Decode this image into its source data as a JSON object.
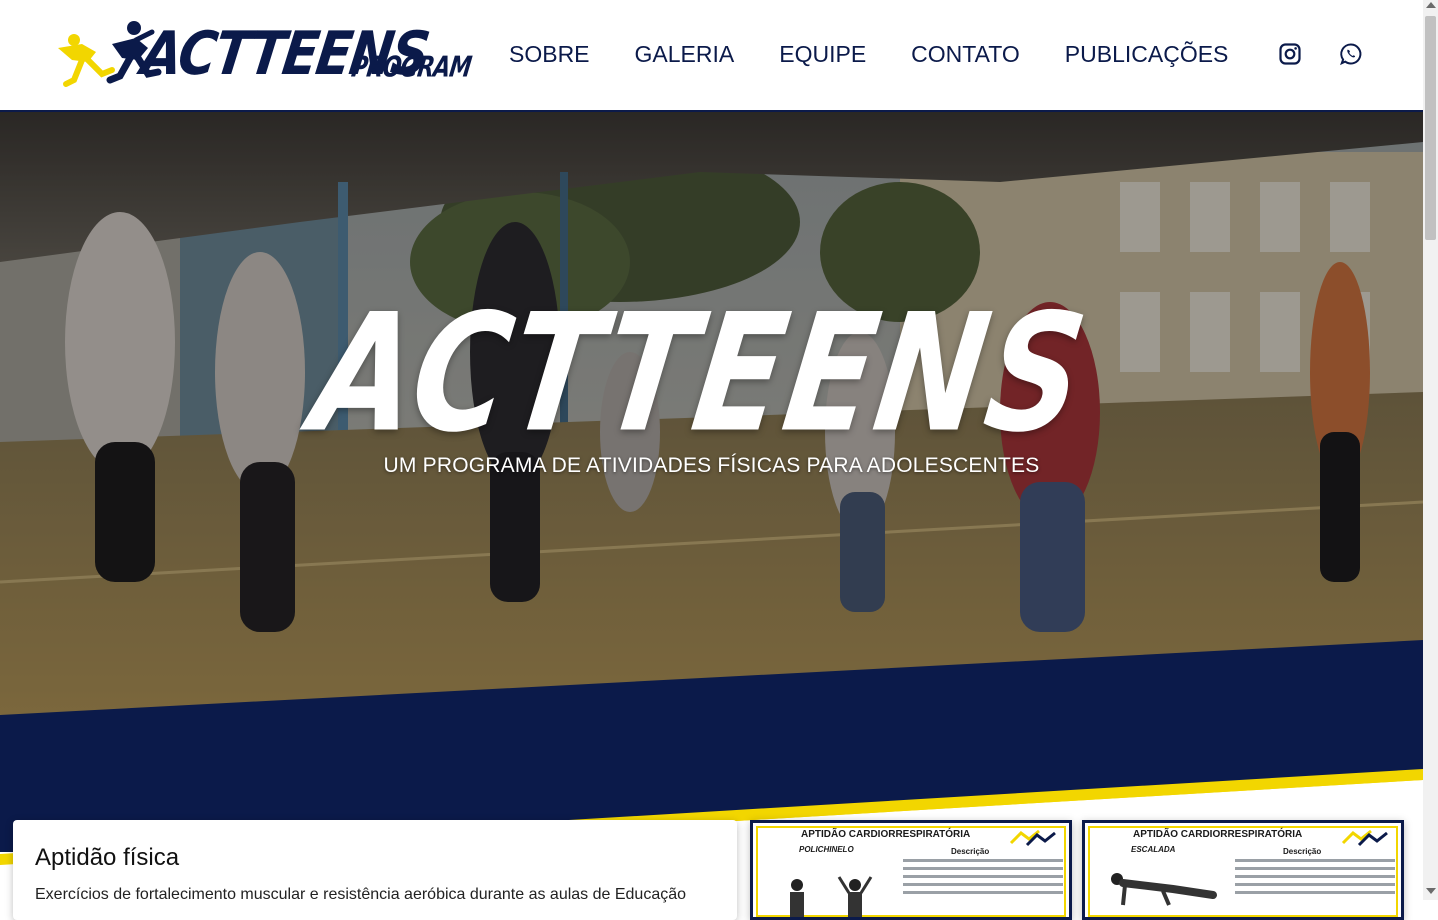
{
  "header": {
    "logo_main": "ACTTEENS",
    "logo_sub": "PROGRAM",
    "nav": [
      "SOBRE",
      "GALERIA",
      "EQUIPE",
      "CONTATO",
      "PUBLICAÇÕES"
    ],
    "social_icons": [
      "instagram-icon",
      "whatsapp-icon"
    ]
  },
  "hero": {
    "title": "ACTTEENS",
    "subtitle": "UM PROGRAMA DE ATIVIDADES FÍSICAS PARA ADOLESCENTES"
  },
  "card": {
    "title": "Aptidão física",
    "text": "Exercícios de fortalecimento muscular e resistência aeróbica durante as aulas de Educação"
  },
  "thumbs": [
    {
      "heading": "APTIDÃO CARDIORRESPIRATÓRIA",
      "name": "POLICHINELO",
      "desc": "Descrição"
    },
    {
      "heading": "APTIDÃO CARDIORRESPIRATÓRIA",
      "name": "ESCALADA",
      "desc": "Descrição"
    }
  ],
  "colors": {
    "navy": "#0b1a4a",
    "yellow": "#f2d600",
    "white": "#ffffff"
  }
}
